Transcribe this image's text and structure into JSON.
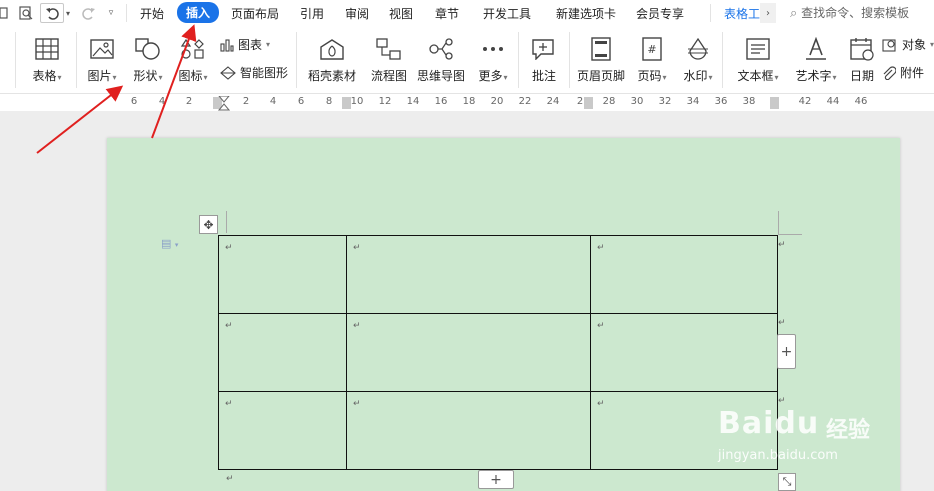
{
  "menu": {
    "items": [
      "开始",
      "插入",
      "页面布局",
      "引用",
      "审阅",
      "视图",
      "章节",
      "开发工具",
      "新建选项卡",
      "会员专享"
    ],
    "active": "插入",
    "table_tools": "表格工",
    "search_placeholder": "查找命令、搜索模板"
  },
  "ribbon": {
    "table": "表格",
    "picture": "图片",
    "shape": "形状",
    "icon": "图标",
    "chart": "图表",
    "smart_art": "智能图形",
    "material": "稻壳素材",
    "flowchart": "流程图",
    "mindmap": "思维导图",
    "more": "更多",
    "comment": "批注",
    "header_footer": "页眉页脚",
    "page_number": "页码",
    "watermark": "水印",
    "text_box": "文本框",
    "word_art": "艺术字",
    "date": "日期",
    "object": "对象",
    "attachment": "附件"
  },
  "ruler": {
    "ticks": [
      "6",
      "4",
      "2",
      "2",
      "4",
      "6",
      "8",
      "10",
      "12",
      "14",
      "16",
      "18",
      "20",
      "22",
      "24",
      "2",
      "28",
      "30",
      "32",
      "34",
      "36",
      "38",
      "42",
      "44",
      "46"
    ]
  },
  "document": {
    "paragraph_mark": "↵",
    "table": {
      "rows": 3,
      "cols": 3
    }
  },
  "watermark": {
    "brand": "Baidu",
    "brand_cn": "经验",
    "url": "jingyan.baidu.com"
  },
  "colors": {
    "accent": "#1a73e8",
    "page_background": "#cce8cf",
    "annotation_arrow": "#e0201f"
  }
}
